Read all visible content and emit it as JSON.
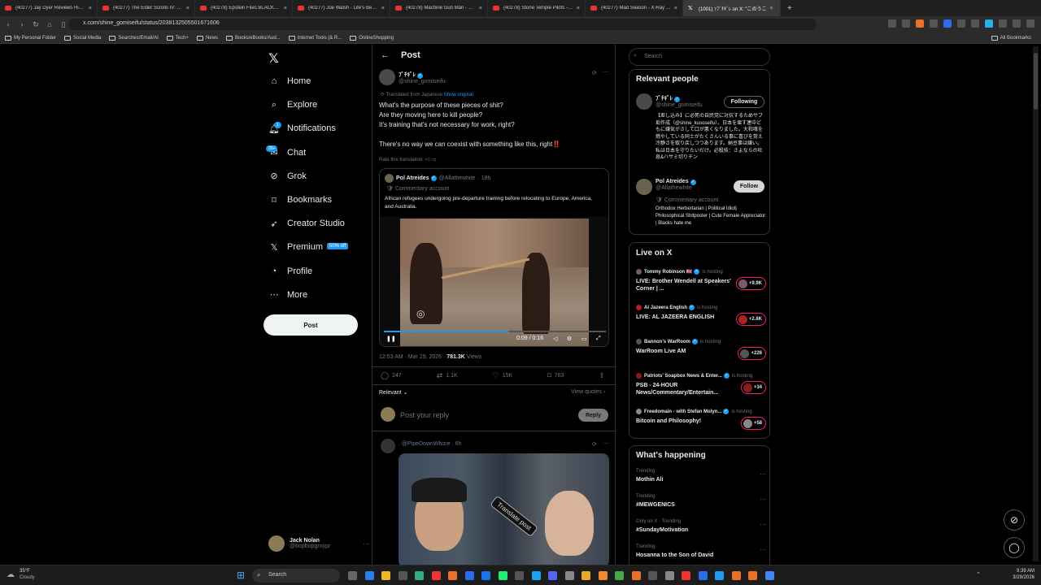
{
  "browser": {
    "tabs": [
      {
        "label": "(40277) Jay Dyer Reviews His Debate",
        "active": false
      },
      {
        "label": "(40277) The Elder Scrolls IV: Oblivion",
        "active": false
      },
      {
        "label": "(40278) Epstein Files BLACKOUT After",
        "active": false
      },
      {
        "label": "(40277) Joe Walsh - Life's Been Good",
        "active": false
      },
      {
        "label": "(40278) Machine Gun Man - YouTube",
        "active": false
      },
      {
        "label": "(40278) Stone Temple Pilots - MTV U",
        "active": false
      },
      {
        "label": "(40277) Mad Season - X-Ray Mind (L",
        "active": false
      },
      {
        "label": "(1001) ｧﾌﾞﾁｷﾞﾚ on X: \"このうこ",
        "active": true
      }
    ],
    "url": "x.com/shine_gomiseifu/status/2038132505501671606",
    "bookmarks": [
      "My Personal Folder",
      "Social Media",
      "Searches/Email/AI",
      "Tech+",
      "News",
      "Books/eBooks/Aud...",
      "Internet Tools (& R...",
      "OnlineShopping"
    ],
    "all_bookmarks": "All Bookmarks"
  },
  "nav": {
    "items": [
      {
        "label": "Home",
        "icon": "home-icon"
      },
      {
        "label": "Explore",
        "icon": "search-icon"
      },
      {
        "label": "Notifications",
        "icon": "bell-icon"
      },
      {
        "label": "Chat",
        "icon": "chat-icon"
      },
      {
        "label": "Grok",
        "icon": "grok-icon"
      },
      {
        "label": "Bookmarks",
        "icon": "bookmark-icon"
      },
      {
        "label": "Creator Studio",
        "icon": "rocket-icon"
      },
      {
        "label": "Premium",
        "icon": "x-icon"
      },
      {
        "label": "Profile",
        "icon": "user-icon"
      },
      {
        "label": "More",
        "icon": "more-icon"
      }
    ],
    "notif_badge": "1",
    "chat_badge": "20+",
    "premium_badge": "50% off",
    "post_button": "Post",
    "account": {
      "name": "Jack Nolan",
      "handle": "@bopbopgroypr"
    }
  },
  "post": {
    "header": "Post",
    "author_name": "ﾌﾞﾁｷﾞﾚ",
    "author_handle": "@shine_gomiseifu",
    "translated": "Translated from Japanese",
    "show_original": "Show original",
    "lines": [
      "What's the purpose of these pieces of shit?",
      "Are they moving here to kill people?",
      "It's training that's not necessary for work, right?",
      "There's no way we can coexist with something like this, right‼️"
    ],
    "rate": "Rate this translation:",
    "quote": {
      "name": "Pol Atreides",
      "handle": "@Allathewhite",
      "time": "18h",
      "commentary": "Commentary account",
      "text": "African refugees undergoing pre-departure training before relocating to Europe, America, and Australia.",
      "video_time": "0:09 / 0:16",
      "progress": 0.56
    },
    "timestamp": "12:53 AM · Mar 29, 2026 · ",
    "views": "781.3K",
    "views_label": " Views",
    "replies": "247",
    "reposts": "1.1K",
    "likes": "15K",
    "bookmarks": "763",
    "relevant": "Relevant",
    "view_quotes": "View quotes",
    "reply_placeholder": "Post your reply",
    "reply_button": "Reply",
    "next_reply": {
      "handle": "@PipeDownWhore",
      "time": "6h",
      "overlay": "Translate post"
    }
  },
  "right": {
    "search_placeholder": "Search",
    "relevant_title": "Relevant people",
    "people": [
      {
        "name": "ﾌﾞﾁｷﾞﾚ",
        "handle": "@shine_gomiseifu",
        "button": "Following",
        "bio": "【差し込み】に必死の自民党に対抗するためサブ垢作成（@shine_kusoseifu）。日本を壊す連中どもに嫌気がさして口が悪くなりました。大和魂を燃やしている同士がたくさんいる事に喜びを覚え冷静さを取り戻しつつあります。納豆事は嫌い。私は日本を守りたいだけ。必殺技：さよならの吐息&ハサミ切りチン"
      },
      {
        "name": "Pol Atreides",
        "handle": "@Allathewhite",
        "button": "Follow",
        "sub": "Commentary account",
        "bio": "Orthodox Herbertarian | Political Idiot| Philosophical Shitposter | Cute Female Appreciator | Blacks hate me"
      }
    ],
    "live_title": "Live on X",
    "live": [
      {
        "host": "Tommy Robinson 🇬🇧",
        "hosting": "is hosting",
        "title": "LIVE: Brother Wendell at Speakers' Corner | ...",
        "count": "+9.9K"
      },
      {
        "host": "Al Jazeera English",
        "hosting": "is hosting",
        "title": "LIVE: AL JAZEERA ENGLISH",
        "count": "+2.6K"
      },
      {
        "host": "Bannon's WarRoom",
        "hosting": "is hosting",
        "title": "WarRoom Live AM",
        "count": "+226"
      },
      {
        "host": "Patriots' Soapbox News & Enter...",
        "hosting": "is hosting",
        "title": "PSB - 24-HOUR News/Commentary/Entertain...",
        "count": "+34"
      },
      {
        "host": "Freedomain - with Stefan Molyn...",
        "hosting": "is hosting",
        "title": "Bitcoin and Philosophy!",
        "count": "+58"
      }
    ],
    "happening_title": "What's happening",
    "trends": [
      {
        "context": "Trending",
        "title": "Mothin Ali"
      },
      {
        "context": "Trending",
        "title": "#MEWGENICS"
      },
      {
        "context": "Only on X · Trending",
        "title": "#SundayMotivation"
      },
      {
        "context": "Trending",
        "title": "Hosanna to the Son of David"
      }
    ]
  },
  "taskbar": {
    "weather_temp": "35°F",
    "weather_desc": "Cloudy",
    "search": "Search",
    "time": "9:39 AM",
    "date": "3/29/2026"
  }
}
